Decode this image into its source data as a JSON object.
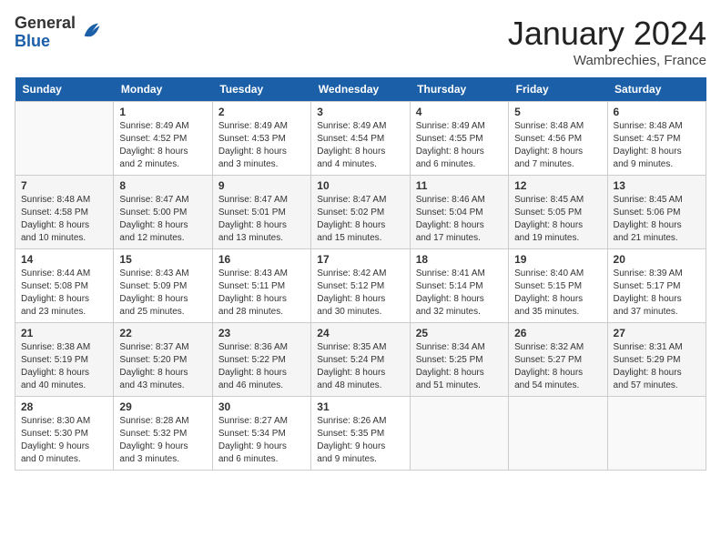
{
  "logo": {
    "general": "General",
    "blue": "Blue"
  },
  "header": {
    "month": "January 2024",
    "location": "Wambrechies, France"
  },
  "weekdays": [
    "Sunday",
    "Monday",
    "Tuesday",
    "Wednesday",
    "Thursday",
    "Friday",
    "Saturday"
  ],
  "weeks": [
    [
      {
        "day": "",
        "info": ""
      },
      {
        "day": "1",
        "info": "Sunrise: 8:49 AM\nSunset: 4:52 PM\nDaylight: 8 hours\nand 2 minutes."
      },
      {
        "day": "2",
        "info": "Sunrise: 8:49 AM\nSunset: 4:53 PM\nDaylight: 8 hours\nand 3 minutes."
      },
      {
        "day": "3",
        "info": "Sunrise: 8:49 AM\nSunset: 4:54 PM\nDaylight: 8 hours\nand 4 minutes."
      },
      {
        "day": "4",
        "info": "Sunrise: 8:49 AM\nSunset: 4:55 PM\nDaylight: 8 hours\nand 6 minutes."
      },
      {
        "day": "5",
        "info": "Sunrise: 8:48 AM\nSunset: 4:56 PM\nDaylight: 8 hours\nand 7 minutes."
      },
      {
        "day": "6",
        "info": "Sunrise: 8:48 AM\nSunset: 4:57 PM\nDaylight: 8 hours\nand 9 minutes."
      }
    ],
    [
      {
        "day": "7",
        "info": "Sunrise: 8:48 AM\nSunset: 4:58 PM\nDaylight: 8 hours\nand 10 minutes."
      },
      {
        "day": "8",
        "info": "Sunrise: 8:47 AM\nSunset: 5:00 PM\nDaylight: 8 hours\nand 12 minutes."
      },
      {
        "day": "9",
        "info": "Sunrise: 8:47 AM\nSunset: 5:01 PM\nDaylight: 8 hours\nand 13 minutes."
      },
      {
        "day": "10",
        "info": "Sunrise: 8:47 AM\nSunset: 5:02 PM\nDaylight: 8 hours\nand 15 minutes."
      },
      {
        "day": "11",
        "info": "Sunrise: 8:46 AM\nSunset: 5:04 PM\nDaylight: 8 hours\nand 17 minutes."
      },
      {
        "day": "12",
        "info": "Sunrise: 8:45 AM\nSunset: 5:05 PM\nDaylight: 8 hours\nand 19 minutes."
      },
      {
        "day": "13",
        "info": "Sunrise: 8:45 AM\nSunset: 5:06 PM\nDaylight: 8 hours\nand 21 minutes."
      }
    ],
    [
      {
        "day": "14",
        "info": "Sunrise: 8:44 AM\nSunset: 5:08 PM\nDaylight: 8 hours\nand 23 minutes."
      },
      {
        "day": "15",
        "info": "Sunrise: 8:43 AM\nSunset: 5:09 PM\nDaylight: 8 hours\nand 25 minutes."
      },
      {
        "day": "16",
        "info": "Sunrise: 8:43 AM\nSunset: 5:11 PM\nDaylight: 8 hours\nand 28 minutes."
      },
      {
        "day": "17",
        "info": "Sunrise: 8:42 AM\nSunset: 5:12 PM\nDaylight: 8 hours\nand 30 minutes."
      },
      {
        "day": "18",
        "info": "Sunrise: 8:41 AM\nSunset: 5:14 PM\nDaylight: 8 hours\nand 32 minutes."
      },
      {
        "day": "19",
        "info": "Sunrise: 8:40 AM\nSunset: 5:15 PM\nDaylight: 8 hours\nand 35 minutes."
      },
      {
        "day": "20",
        "info": "Sunrise: 8:39 AM\nSunset: 5:17 PM\nDaylight: 8 hours\nand 37 minutes."
      }
    ],
    [
      {
        "day": "21",
        "info": "Sunrise: 8:38 AM\nSunset: 5:19 PM\nDaylight: 8 hours\nand 40 minutes."
      },
      {
        "day": "22",
        "info": "Sunrise: 8:37 AM\nSunset: 5:20 PM\nDaylight: 8 hours\nand 43 minutes."
      },
      {
        "day": "23",
        "info": "Sunrise: 8:36 AM\nSunset: 5:22 PM\nDaylight: 8 hours\nand 46 minutes."
      },
      {
        "day": "24",
        "info": "Sunrise: 8:35 AM\nSunset: 5:24 PM\nDaylight: 8 hours\nand 48 minutes."
      },
      {
        "day": "25",
        "info": "Sunrise: 8:34 AM\nSunset: 5:25 PM\nDaylight: 8 hours\nand 51 minutes."
      },
      {
        "day": "26",
        "info": "Sunrise: 8:32 AM\nSunset: 5:27 PM\nDaylight: 8 hours\nand 54 minutes."
      },
      {
        "day": "27",
        "info": "Sunrise: 8:31 AM\nSunset: 5:29 PM\nDaylight: 8 hours\nand 57 minutes."
      }
    ],
    [
      {
        "day": "28",
        "info": "Sunrise: 8:30 AM\nSunset: 5:30 PM\nDaylight: 9 hours\nand 0 minutes."
      },
      {
        "day": "29",
        "info": "Sunrise: 8:28 AM\nSunset: 5:32 PM\nDaylight: 9 hours\nand 3 minutes."
      },
      {
        "day": "30",
        "info": "Sunrise: 8:27 AM\nSunset: 5:34 PM\nDaylight: 9 hours\nand 6 minutes."
      },
      {
        "day": "31",
        "info": "Sunrise: 8:26 AM\nSunset: 5:35 PM\nDaylight: 9 hours\nand 9 minutes."
      },
      {
        "day": "",
        "info": ""
      },
      {
        "day": "",
        "info": ""
      },
      {
        "day": "",
        "info": ""
      }
    ]
  ]
}
